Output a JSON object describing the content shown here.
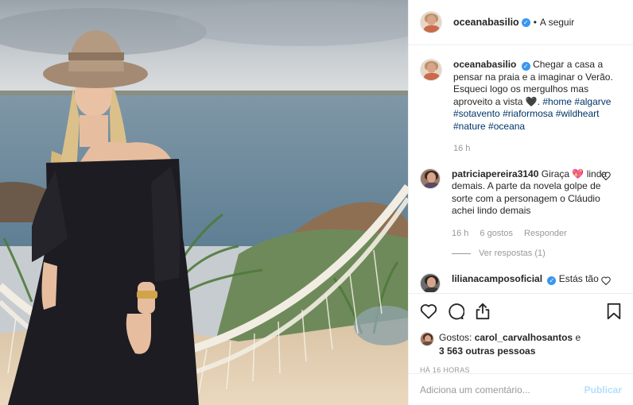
{
  "post": {
    "photo_alt": "",
    "author": {
      "username": "oceanabasilio",
      "verified_icon": "verified-badge-icon",
      "follow_label": "A seguir",
      "separator": "•"
    },
    "caption": {
      "username": "oceanabasilio",
      "text": "Chegar a casa a pensar na praia e a imaginar o Verão. Esqueci logo os mergulhos mas aproveito a vista 🖤.",
      "hashtags": [
        "#home",
        "#algarve",
        "#sotavento",
        "#riaformosa",
        "#wildheart",
        "#nature",
        "#oceana"
      ],
      "time": "16 h"
    },
    "comments": [
      {
        "username": "patriciapereira3140",
        "text": "Giraça 💖 linda demais. A parte da novela golpe de sorte com a personagem o Cláudio achei lindo demais",
        "time": "16 h",
        "likes": "6 gostos",
        "reply_label": "Responder",
        "view_replies": "Ver respostas (1)"
      },
      {
        "username": "lilianacamposoficial",
        "text": "Estás tão",
        "verified": true
      }
    ],
    "actions": {
      "like_icon": "heart-icon",
      "comment_icon": "comment-bubble-icon",
      "share_icon": "share-icon",
      "save_icon": "bookmark-icon"
    },
    "likes": {
      "prefix": "Gostos:",
      "user": "carol_carvalhosantos",
      "connector": "e",
      "others": "3 563 outras pessoas"
    },
    "posted_ago": "HÁ 16 HORAS",
    "add_comment": {
      "placeholder": "Adiciona um comentário...",
      "publish_label": "Publicar"
    }
  },
  "colors": {
    "link": "#003569",
    "muted": "#999999",
    "verified": "#3897f0",
    "publish_disabled": "#b2dffc"
  }
}
